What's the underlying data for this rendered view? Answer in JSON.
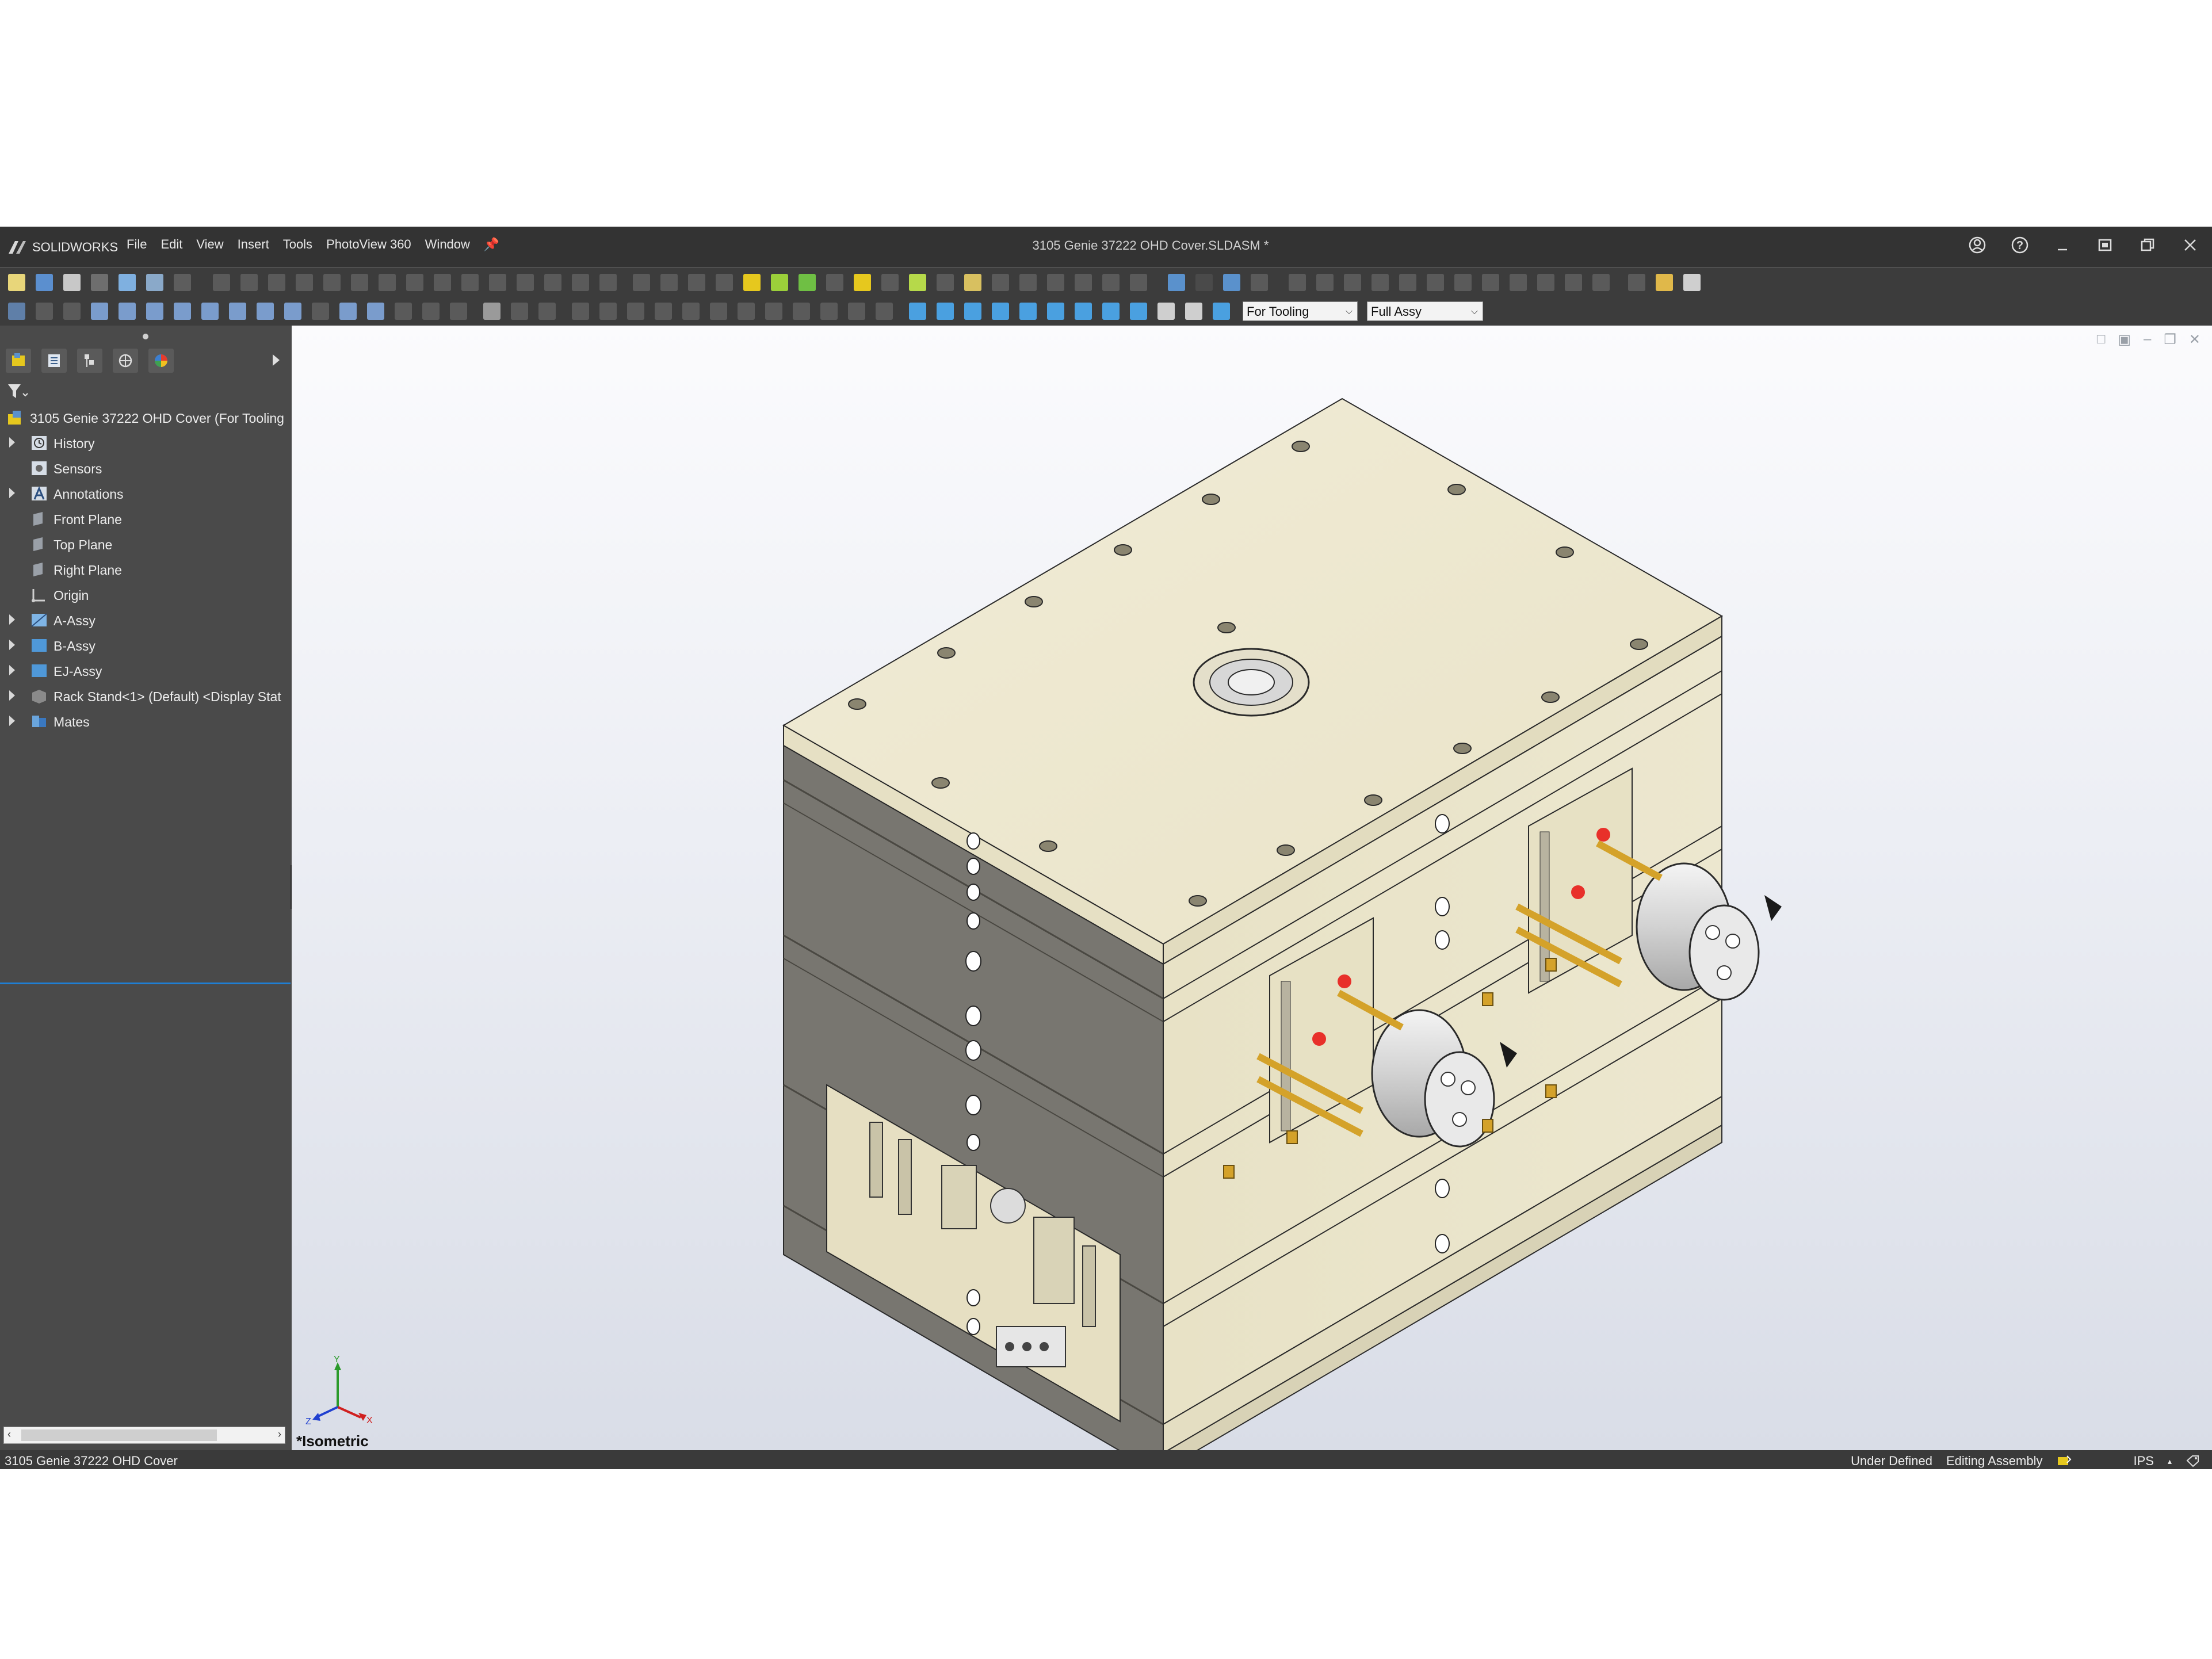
{
  "app": {
    "logo_text": "SOLIDWORKS"
  },
  "menu": [
    "File",
    "Edit",
    "View",
    "Insert",
    "Tools",
    "PhotoView 360",
    "Window"
  ],
  "document_title": "3105 Genie 37222 OHD Cover.SLDASM *",
  "toolbar": {
    "config_combo": "For Tooling",
    "display_state_combo": "Full Assy"
  },
  "feature_tree": {
    "root": "3105 Genie 37222 OHD Cover (For Tooling",
    "items": [
      {
        "label": "History",
        "expandable": true,
        "icon": "history-icon"
      },
      {
        "label": "Sensors",
        "expandable": false,
        "icon": "sensors-icon"
      },
      {
        "label": "Annotations",
        "expandable": true,
        "icon": "annotations-icon"
      },
      {
        "label": "Front Plane",
        "expandable": false,
        "icon": "plane-icon"
      },
      {
        "label": "Top Plane",
        "expandable": false,
        "icon": "plane-icon"
      },
      {
        "label": "Right Plane",
        "expandable": false,
        "icon": "plane-icon"
      },
      {
        "label": "Origin",
        "expandable": false,
        "icon": "origin-icon"
      },
      {
        "label": "A-Assy",
        "expandable": true,
        "icon": "subassembly-icon"
      },
      {
        "label": "B-Assy",
        "expandable": true,
        "icon": "subassembly-icon"
      },
      {
        "label": "EJ-Assy",
        "expandable": true,
        "icon": "subassembly-icon"
      },
      {
        "label": "Rack Stand<1> (Default) <Display Stat",
        "expandable": true,
        "icon": "part-icon"
      },
      {
        "label": "Mates",
        "expandable": true,
        "icon": "mates-icon"
      }
    ]
  },
  "viewport": {
    "view_orientation": "*Isometric"
  },
  "status": {
    "left": "3105 Genie 37222 OHD Cover",
    "definition": "Under Defined",
    "mode": "Editing Assembly",
    "units": "IPS"
  },
  "colors": {
    "mold_body": "#efead5",
    "mold_shadow": "#7c7a70",
    "toolbar_bg": "#3c3c3c",
    "titlebar_bg": "#333333",
    "selection_blue": "#1f7fd4"
  }
}
